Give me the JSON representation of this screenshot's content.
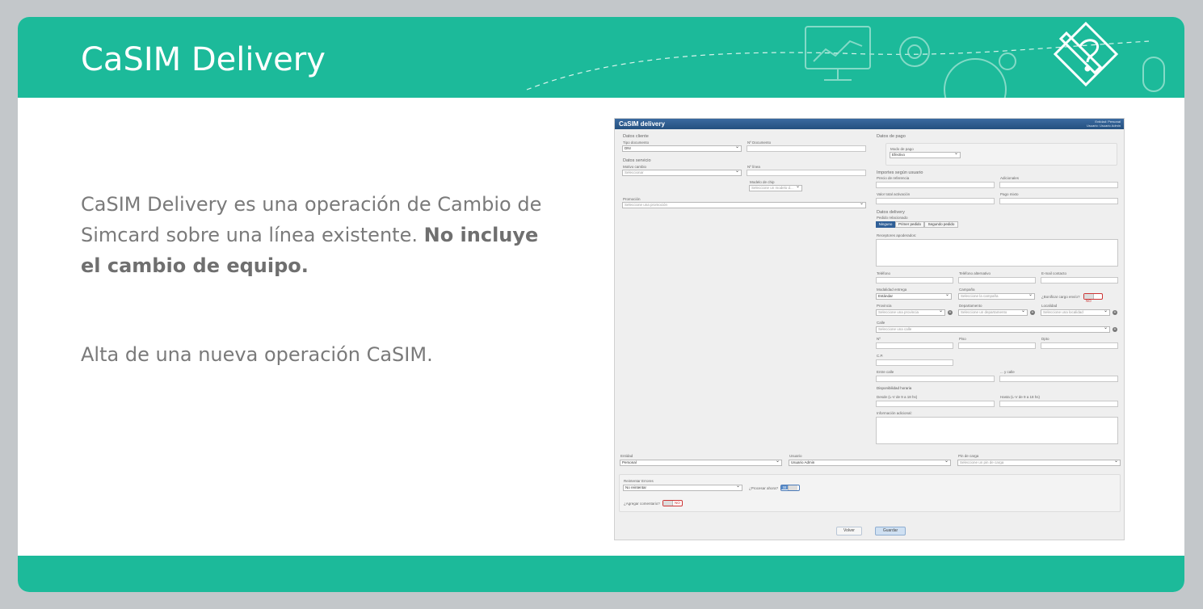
{
  "slide": {
    "title": "CaSIM Delivery",
    "paragraph_1_normal": "CaSIM Delivery es una operación de Cambio de Simcard sobre una línea existente.",
    "paragraph_1_bold": "No incluye el cambio de equipo.",
    "paragraph_2": "Alta de una nueva operación CaSIM."
  },
  "colors": {
    "brand": "#1cba9a",
    "frame": "#c3c7ca",
    "text": "#7a7a7a",
    "app_bar": "#2a5788"
  },
  "app": {
    "title": "CaSIM delivery",
    "entity_info": "Entidad: Personal",
    "user_info": "Usuario: Usuario Admin",
    "datos_cliente": {
      "title": "Datos cliente",
      "tipo_documento_label": "Tipo documento",
      "tipo_documento_value": "DNI",
      "nro_documento_label": "Nº Documento"
    },
    "datos_servicio": {
      "title": "Datos servicio",
      "motivo_label": "Motivo cambio",
      "motivo_placeholder": "Seleccionar",
      "nro_linea_label": "Nº línea",
      "modelo_label": "Modelo de chip",
      "modelo_placeholder": "Seleccione un modelo d...",
      "promocion_label": "Promoción",
      "promocion_placeholder": "Seleccione una promoción"
    },
    "datos_pago": {
      "title": "Datos de pago",
      "modo_label": "Modo de pago",
      "modo_value": "Efectivo"
    },
    "importes": {
      "title": "Importes según usuario",
      "precio_label": "Precio de referencia",
      "adicionales_label": "Adicionales",
      "valor_label": "Valor total activación",
      "pago_label": "Pago mixto"
    },
    "datos_delivery": {
      "title": "Datos delivery",
      "pedido_label": "Pedido relacionado",
      "pedido_options": [
        "Ninguno",
        "Primer pedido",
        "Segundo pedido"
      ],
      "receptores_label": "Receptores apoderados:",
      "telefono_label": "Teléfono",
      "telefono_alt_label": "Teléfono alternativo",
      "email_label": "E-mail contacto",
      "modalidad_label": "Modalidad entrega",
      "modalidad_value": "Estándar",
      "campana_label": "Campaña",
      "campana_placeholder": "Seleccione la campaña",
      "bonificar_label": "¿Bonificar cargo envío?",
      "bonificar_value": "NO",
      "provincia_label": "Provincia",
      "provincia_placeholder": "Seleccione una provincia",
      "departamento_label": "Departamento",
      "departamento_placeholder": "Seleccione un departamento",
      "localidad_label": "Localidad",
      "localidad_placeholder": "Seleccione una localidad",
      "calle_label": "Calle",
      "calle_placeholder": "Seleccione una calle",
      "nro_label": "Nº",
      "piso_label": "Piso",
      "dpto_label": "Dpto",
      "cp_label": "C.P.",
      "entre_calle_label": "Entre calle",
      "y_calle_label": "... y calle",
      "disponibilidad_title": "Disponibilidad horaria",
      "desde_label": "Desde (L-V de 9 a 18 hs)",
      "hasta_label": "Hasta (L-V de 9 a 18 hs)",
      "info_label": "Información adicional:"
    },
    "bottom": {
      "entidad_label": "Entidad",
      "entidad_value": "Personal",
      "usuario_label": "Usuario",
      "usuario_value": "Usuario Admin",
      "pin_label": "Pin de carga",
      "pin_placeholder": "Seleccione un pin de carga",
      "reintentar_label": "Reintentar Errores",
      "reintentar_value": "No reintentar",
      "procesar_label": "¿Procesar ahora?",
      "procesar_value": "SI",
      "comentario_label": "¿Agregar comentario?",
      "comentario_value": "NO",
      "volver": "Volver",
      "guardar": "Guardar"
    }
  }
}
